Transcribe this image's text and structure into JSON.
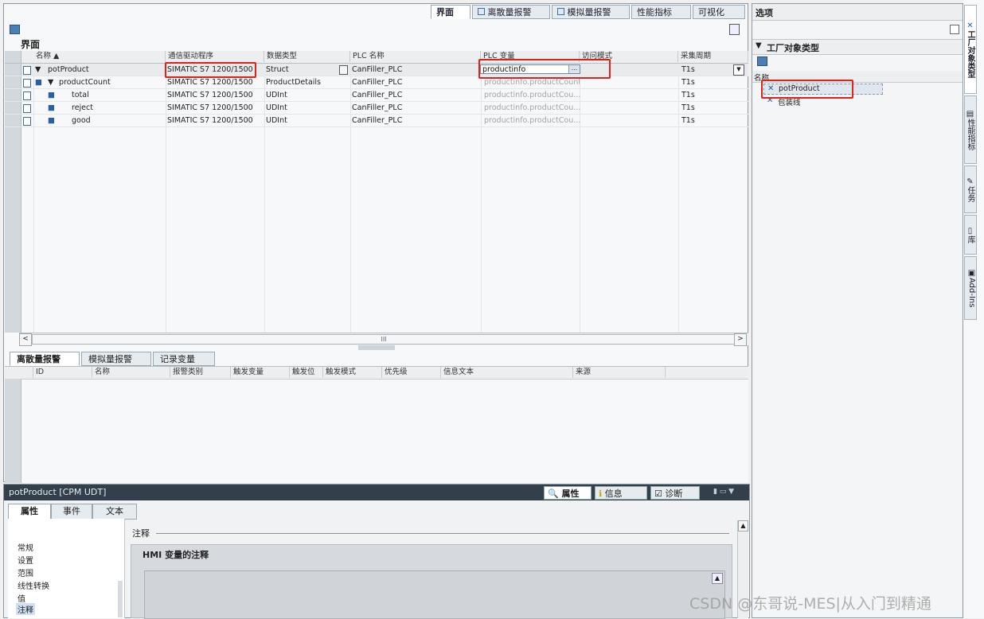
{
  "top_tabs": [
    {
      "label": "界面",
      "active": true
    },
    {
      "label": "离散量报警",
      "active": false
    },
    {
      "label": "模拟量报警",
      "active": false
    },
    {
      "label": "性能指标",
      "active": false
    },
    {
      "label": "可视化",
      "active": false
    }
  ],
  "section_title": "界面",
  "columns": [
    "名称",
    "通信驱动程序",
    "数据类型",
    "PLC 名称",
    "PLC 变量",
    "访问模式",
    "采集周期"
  ],
  "rows": [
    {
      "name": "potProduct",
      "driver": "SIMATIC S7 1200/1500",
      "type": "Struct",
      "plc": "CanFiller_PLC",
      "var": "productinfo",
      "cycle": "T1s"
    },
    {
      "name": "productCount",
      "driver": "SIMATIC S7 1200/1500",
      "type": "ProductDetails",
      "plc": "CanFiller_PLC",
      "var": "productinfo.productCount",
      "cycle": "T1s"
    },
    {
      "name": "total",
      "driver": "SIMATIC S7 1200/1500",
      "type": "UDInt",
      "plc": "CanFiller_PLC",
      "var": "productinfo.productCou...",
      "cycle": "T1s"
    },
    {
      "name": "reject",
      "driver": "SIMATIC S7 1200/1500",
      "type": "UDInt",
      "plc": "CanFiller_PLC",
      "var": "productinfo.productCou...",
      "cycle": "T1s"
    },
    {
      "name": "good",
      "driver": "SIMATIC S7 1200/1500",
      "type": "UDInt",
      "plc": "CanFiller_PLC",
      "var": "productinfo.productCou...",
      "cycle": "T1s"
    }
  ],
  "scroll_mid": "III",
  "bottom_tabs": [
    {
      "label": "离散量报警",
      "active": true
    },
    {
      "label": "模拟量报警",
      "active": false
    },
    {
      "label": "记录变量",
      "active": false
    }
  ],
  "alarm_columns": [
    "ID",
    "名称",
    "报警类别",
    "触发变量",
    "触发位",
    "触发模式",
    "优先级",
    "信息文本",
    "来源"
  ],
  "props": {
    "title": "potProduct [CPM UDT]",
    "view_tabs": [
      "属性",
      "信息",
      "诊断"
    ],
    "sub_tabs": [
      "属性",
      "事件",
      "文本"
    ],
    "nav": [
      "常规",
      "设置",
      "范围",
      "线性转换",
      "值",
      "注释"
    ],
    "comment_label": "注释",
    "comment_heading": "HMI 变量的注释"
  },
  "right_panel": {
    "title": "选项",
    "section": "工厂对象类型",
    "col_header": "名称",
    "items": [
      "potProduct",
      "包装线"
    ]
  },
  "side_tabs": [
    "工厂对象类型",
    "性能指标",
    "任务",
    "库",
    "Add-Ins"
  ],
  "watermark": "CSDN @东哥说-MES|从入门到精通"
}
